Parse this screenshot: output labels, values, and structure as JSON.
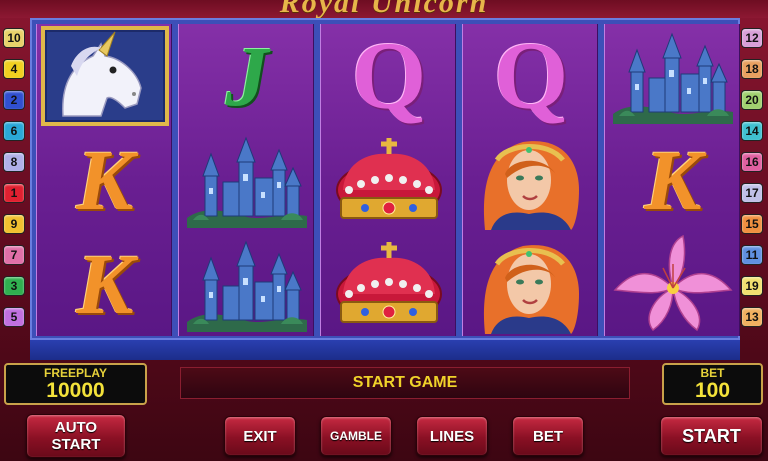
{
  "title": "Royal Unicorn",
  "line_markers": {
    "left": [
      "10",
      "4",
      "2",
      "6",
      "8",
      "1",
      "9",
      "7",
      "3",
      "5"
    ],
    "right": [
      "12",
      "18",
      "20",
      "14",
      "16",
      "17",
      "15",
      "11",
      "19",
      "13"
    ],
    "left_colors": [
      "#e8d26a",
      "#f0d020",
      "#3050d0",
      "#2aa8d8",
      "#b0b0e8",
      "#e02030",
      "#f0c030",
      "#e070a8",
      "#30b050",
      "#c070e0"
    ],
    "right_colors": [
      "#d8a0d8",
      "#e8a060",
      "#a0d070",
      "#40c0d0",
      "#e060a0",
      "#c0c0e8",
      "#f09040",
      "#6090e0",
      "#f0e070",
      "#f0b060"
    ]
  },
  "reels": [
    [
      "unicorn",
      "K",
      "K"
    ],
    [
      "J",
      "castle",
      "castle"
    ],
    [
      "Q",
      "crown",
      "crown"
    ],
    [
      "Q",
      "princess",
      "princess"
    ],
    [
      "castle",
      "K",
      "lily"
    ]
  ],
  "freeplay": {
    "label": "FREEPLAY",
    "value": "10000"
  },
  "bet": {
    "label": "BET",
    "value": "100"
  },
  "message": "START GAME",
  "buttons": {
    "auto_start": "AUTO START",
    "exit": "EXIT",
    "gamble": "GAMBLE",
    "lines": "LINES",
    "bet": "BET",
    "start": "START"
  }
}
